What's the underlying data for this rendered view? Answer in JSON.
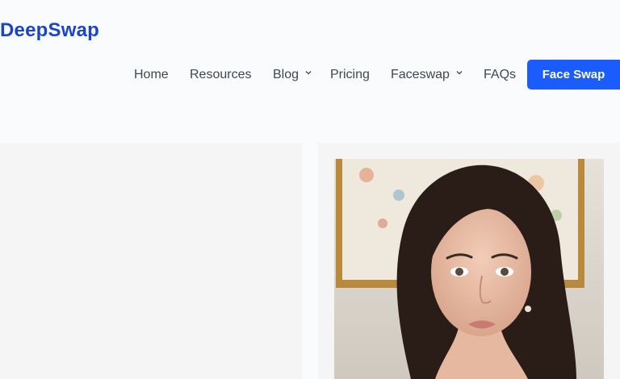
{
  "header": {
    "logo": "DeepSwap"
  },
  "nav": {
    "items": [
      {
        "label": "Home",
        "has_dropdown": false
      },
      {
        "label": "Resources",
        "has_dropdown": false
      },
      {
        "label": "Blog",
        "has_dropdown": true
      },
      {
        "label": "Pricing",
        "has_dropdown": false
      },
      {
        "label": "Faceswap",
        "has_dropdown": true
      },
      {
        "label": "FAQs",
        "has_dropdown": false
      }
    ],
    "cta_label": "Face Swap"
  },
  "colors": {
    "brand": "#1b45c8",
    "cta": "#1b5cff",
    "nav_text": "#3f4652",
    "panel_bg": "#f5f5f5"
  },
  "main": {
    "hero_image": {
      "icon": "portrait-photo"
    }
  }
}
